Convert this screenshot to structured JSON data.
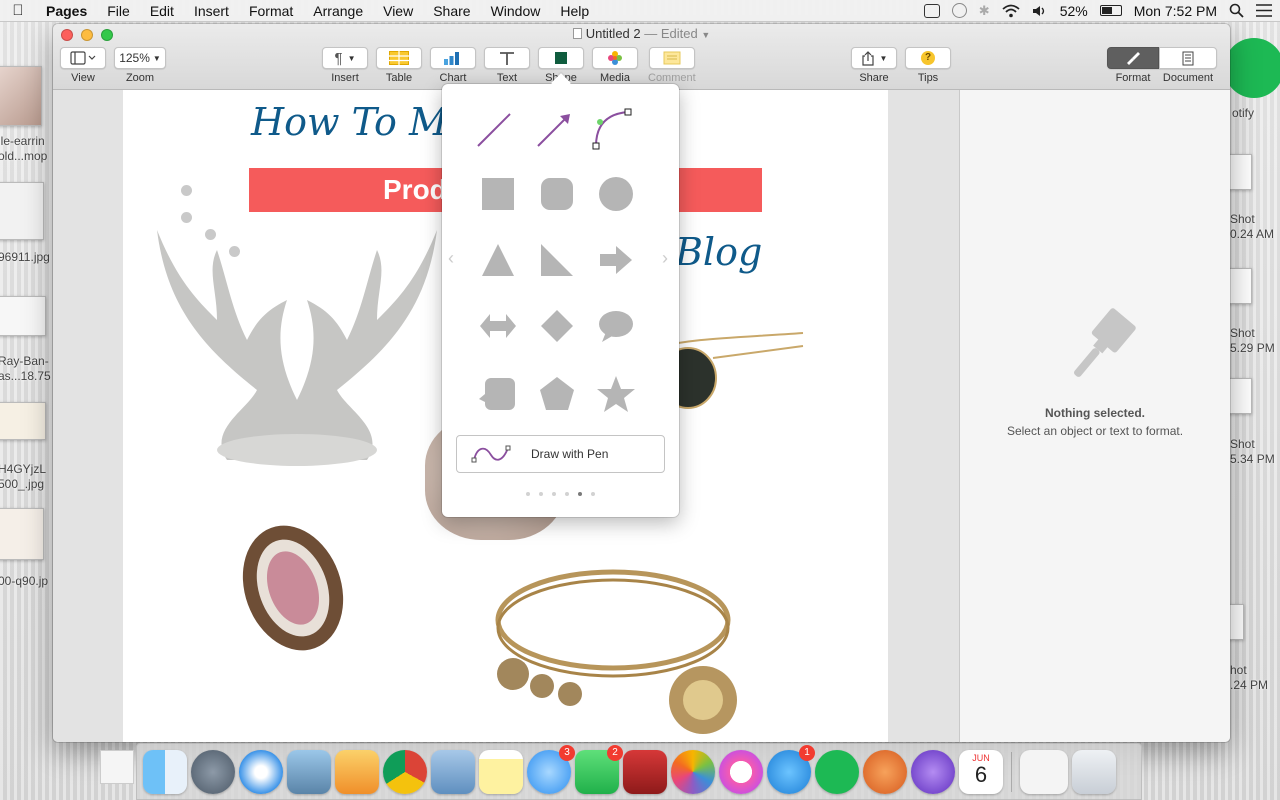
{
  "menubar": {
    "app_name": "Pages",
    "items": [
      "File",
      "Edit",
      "Insert",
      "Format",
      "Arrange",
      "View",
      "Share",
      "Window",
      "Help"
    ],
    "battery": "52%",
    "clock": "Mon 7:52 PM"
  },
  "desktop_files": [
    {
      "label": "lle-earrin\nold...mop"
    },
    {
      "label": "96911.jpg"
    },
    {
      "label": "Ray-Ban-\nas...18.75"
    },
    {
      "label": "H4GYjzL\n500_.jpg"
    },
    {
      "label": "00-q90.jp"
    }
  ],
  "desktop_right": [
    {
      "label": "otify"
    },
    {
      "label": "Shot\n0.24 AM"
    },
    {
      "label": "Shot\n5.29 PM"
    },
    {
      "label": "Shot\n5.34 PM"
    },
    {
      "label": "hot\n.24 PM"
    }
  ],
  "window": {
    "title": "Untitled 2",
    "edited": "— Edited"
  },
  "toolbar": {
    "view": "View",
    "zoom": "Zoom",
    "zoom_value": "125%",
    "insert": "Insert",
    "table": "Table",
    "chart": "Chart",
    "text": "Text",
    "shape": "Shape",
    "media": "Media",
    "comment": "Comment",
    "share": "Share",
    "tips": "Tips",
    "format": "Format",
    "document": "Document"
  },
  "document": {
    "title": "How To Make",
    "banner": "Prod",
    "blog_word": "Blog"
  },
  "sidebar": {
    "heading": "Nothing selected.",
    "sub": "Select an object or text to format."
  },
  "shape_popover": {
    "draw_with_pen": "Draw with Pen",
    "page_count": 6,
    "current_page": 5
  },
  "dock": {
    "badges": {
      "messages": "3",
      "facetime": "2",
      "appstore": "1"
    },
    "calendar_month": "JUN",
    "calendar_day": "6"
  }
}
